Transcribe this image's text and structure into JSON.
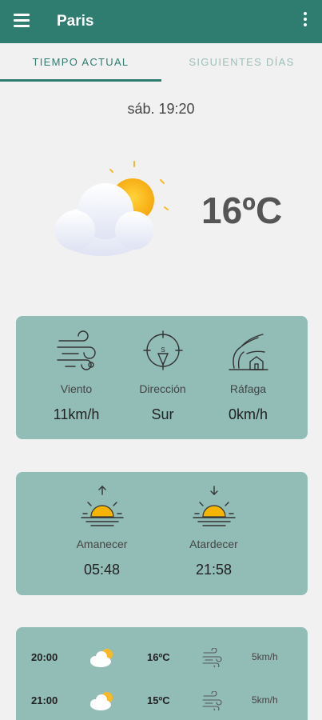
{
  "appbar": {
    "title": "Paris",
    "menu_icon": "hamburger-menu-icon",
    "more_icon": "more-vert-icon",
    "color": "#2f7c70"
  },
  "tabs": [
    {
      "label": "TIEMPO ACTUAL",
      "active": true
    },
    {
      "label": "SIGUIENTES DÍAS",
      "active": false
    }
  ],
  "current": {
    "datetime": "sáb. 19:20",
    "temperature": "16ºC",
    "condition_icon": "partly-cloudy-icon"
  },
  "wind_card": {
    "items": [
      {
        "icon": "wind-icon",
        "label": "Viento",
        "value": "11km/h"
      },
      {
        "icon": "compass-direction-icon",
        "label": "Dirección",
        "value": "Sur"
      },
      {
        "icon": "wind-gust-house-icon",
        "label": "Ráfaga",
        "value": "0km/h"
      }
    ],
    "color": "#92bcb6"
  },
  "sun_card": {
    "items": [
      {
        "icon": "sunrise-icon",
        "label": "Amanecer",
        "value": "05:48"
      },
      {
        "icon": "sunset-icon",
        "label": "Atardecer",
        "value": "21:58"
      }
    ]
  },
  "hourly": [
    {
      "hour": "20:00",
      "icon": "partly-cloudy-icon",
      "temp": "16ºC",
      "wind_icon": "wind-icon",
      "speed": "5km/h"
    },
    {
      "hour": "21:00",
      "icon": "partly-cloudy-icon",
      "temp": "15ºC",
      "wind_icon": "wind-icon",
      "speed": "5km/h"
    }
  ]
}
